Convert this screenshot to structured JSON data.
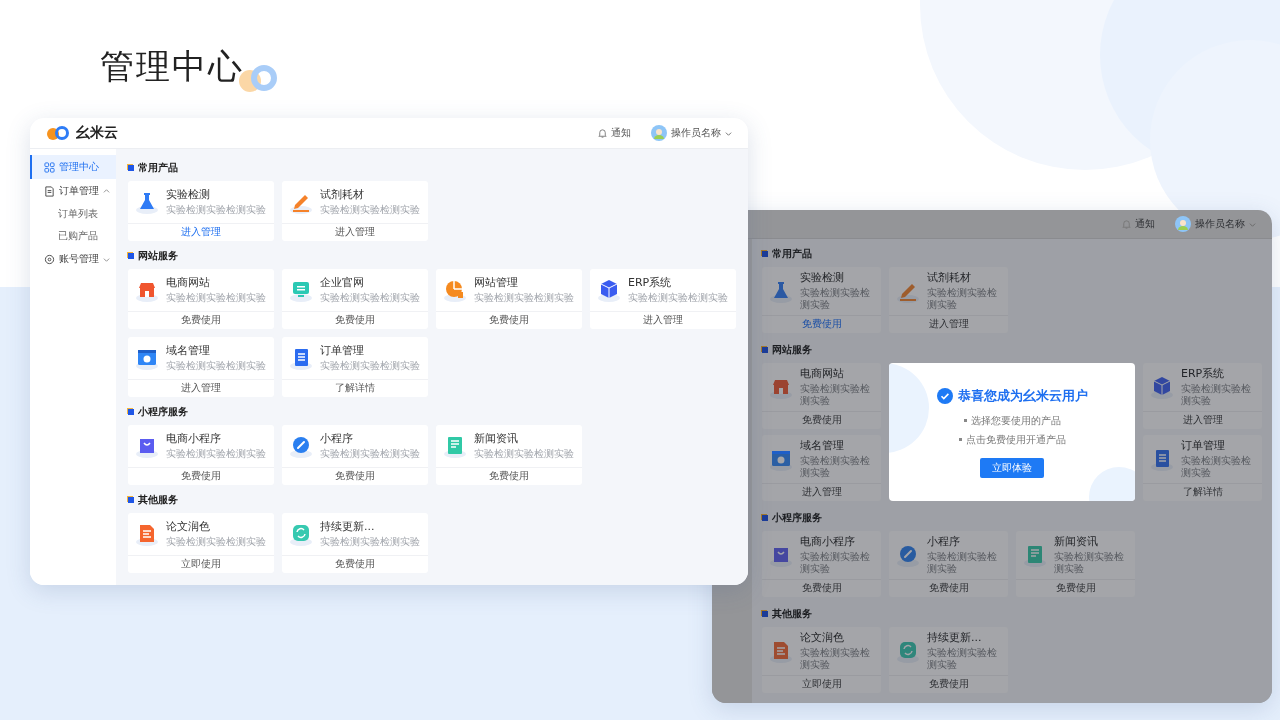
{
  "page_title": "管理中心",
  "main_window": {
    "header": {
      "logo_text": "幺米云",
      "notice": "通知",
      "user": "操作员名称"
    },
    "sidebar": [
      {
        "label": "管理中心",
        "kind": "grid",
        "selected": true
      },
      {
        "label": "订单管理",
        "kind": "doc",
        "selected": false,
        "expanded": true,
        "children": [
          {
            "label": "订单列表",
            "selected": false
          },
          {
            "label": "已购产品",
            "selected": false
          }
        ]
      },
      {
        "label": "账号管理",
        "kind": "gear",
        "selected": false,
        "expanded": false
      }
    ],
    "sections": [
      {
        "title": "常用产品",
        "cards": [
          {
            "name": "实验检测",
            "desc": "实验检测实验检测实验",
            "action": "进入管理",
            "kind": "flask",
            "color": "#2f7bf5",
            "active": true
          },
          {
            "name": "试剂耗材",
            "desc": "实验检测实验检测实验",
            "action": "进入管理",
            "kind": "pencil",
            "color": "#f5822a",
            "active": false
          }
        ]
      },
      {
        "title": "网站服务",
        "cards": [
          {
            "name": "电商网站",
            "desc": "实验检测实验检测实验",
            "action": "免费使用",
            "kind": "shop",
            "color": "#f0552e",
            "active": false
          },
          {
            "name": "企业官网",
            "desc": "实验检测实验检测实验",
            "action": "免费使用",
            "kind": "screen",
            "color": "#2bc9b4",
            "active": false
          },
          {
            "name": "网站管理",
            "desc": "实验检测实验检测实验",
            "action": "免费使用",
            "kind": "chart",
            "color": "#f58a1f",
            "active": false
          },
          {
            "name": "ERP系统",
            "desc": "实验检测实验检测实验",
            "action": "进入管理",
            "kind": "cube",
            "color": "#3a5cf0",
            "active": false
          },
          {
            "name": "域名管理",
            "desc": "实验检测实验检测实验",
            "action": "进入管理",
            "kind": "browser",
            "color": "#2f86f6",
            "active": false
          },
          {
            "name": "订单管理",
            "desc": "实验检测实验检测实验",
            "action": "了解详情",
            "kind": "document",
            "color": "#2b6cf0",
            "active": false
          }
        ]
      },
      {
        "title": "小程序服务",
        "cards": [
          {
            "name": "电商小程序",
            "desc": "实验检测实验检测实验",
            "action": "免费使用",
            "kind": "bag",
            "color": "#5b5cf0",
            "active": false
          },
          {
            "name": "小程序",
            "desc": "实验检测实验检测实验",
            "action": "免费使用",
            "kind": "link",
            "color": "#2a7ff0",
            "active": false
          },
          {
            "name": "新闻资讯",
            "desc": "实验检测实验检测实验",
            "action": "免费使用",
            "kind": "news",
            "color": "#30c9a6",
            "active": false
          }
        ]
      },
      {
        "title": "其他服务",
        "cards": [
          {
            "name": "论文润色",
            "desc": "实验检测实验检测实验",
            "action": "立即使用",
            "kind": "file",
            "color": "#f5652e",
            "active": false
          },
          {
            "name": "持续更新...",
            "desc": "实验检测实验检测实验",
            "action": "免费使用",
            "kind": "refresh",
            "color": "#36c9b0",
            "active": false
          }
        ]
      }
    ]
  },
  "second_window": {
    "header": {
      "notice": "通知",
      "user": "操作员名称"
    },
    "sections": [
      {
        "title": "常用产品",
        "cards": [
          {
            "name": "实验检测",
            "desc": "实验检测实验检测实验",
            "action": "免费使用",
            "kind": "flask",
            "color": "#2b59a3",
            "active": true
          },
          {
            "name": "试剂耗材",
            "desc": "实验检测实验检测实验",
            "action": "进入管理",
            "kind": "pencil",
            "color": "#9e5d2d",
            "active": false
          }
        ]
      },
      {
        "title": "网站服务",
        "dialog": {
          "title": "恭喜您成为幺米云用户",
          "bullets": [
            "选择您要使用的产品",
            "点击免费使用开通产品"
          ],
          "button": "立即体验"
        },
        "cards": [
          {
            "name": "电商网站",
            "desc": "实验检测实验检测实验",
            "action": "免费使用",
            "kind": "shop",
            "color": "#9b4330",
            "active": false
          },
          {
            "name": "ERP系统",
            "desc": "实验检测实验检测实验",
            "action": "进入管理",
            "kind": "cube",
            "color": "#3247a0",
            "active": false
          },
          {
            "name": "域名管理",
            "desc": "实验检测实验检测实验",
            "action": "进入管理",
            "kind": "browser",
            "color": "#2b5fa4",
            "active": false
          },
          {
            "name": "订单管理",
            "desc": "实验检测实验检测实验",
            "action": "了解详情",
            "kind": "document",
            "color": "#2950a0",
            "active": false
          }
        ]
      },
      {
        "title": "小程序服务",
        "cards": [
          {
            "name": "电商小程序",
            "desc": "实验检测实验检测实验",
            "action": "免费使用",
            "kind": "bag",
            "color": "#4547a0",
            "active": false
          },
          {
            "name": "小程序",
            "desc": "实验检测实验检测实验",
            "action": "免费使用",
            "kind": "link",
            "color": "#285ba0",
            "active": false
          },
          {
            "name": "新闻资讯",
            "desc": "实验检测实验检测实验",
            "action": "免费使用",
            "kind": "news",
            "color": "#2c8675",
            "active": false
          }
        ]
      },
      {
        "title": "其他服务",
        "cards": [
          {
            "name": "论文润色",
            "desc": "实验检测实验检测实验",
            "action": "立即使用",
            "kind": "file",
            "color": "#9e4c30",
            "active": false
          },
          {
            "name": "持续更新...",
            "desc": "实验检测实验检测实验",
            "action": "免费使用",
            "kind": "refresh",
            "color": "#2f867b",
            "active": false
          }
        ]
      }
    ]
  }
}
